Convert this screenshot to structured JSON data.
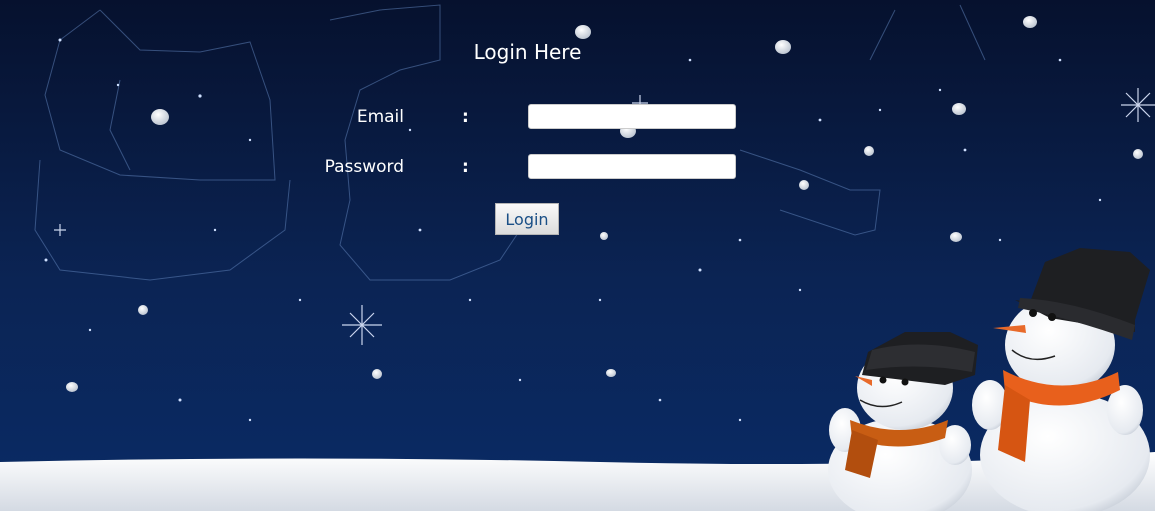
{
  "login": {
    "title": "Login Here",
    "email_label": "Email",
    "password_label": "Password",
    "colon": ":",
    "email_value": "",
    "password_value": "",
    "button_label": "Login"
  },
  "colors": {
    "sky_top": "#06112e",
    "sky_bottom": "#0a2b66",
    "snow": "#eef1f6",
    "scarf": "#e8601c",
    "button_text": "#1a4f86"
  }
}
